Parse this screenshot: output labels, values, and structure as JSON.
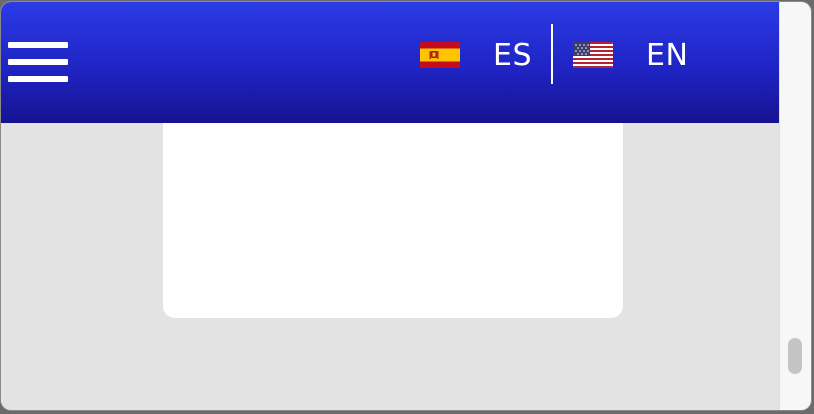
{
  "header": {
    "menu_icon": "hamburger-menu-icon",
    "languages": [
      {
        "code": "ES",
        "flag": "spain-flag-icon"
      },
      {
        "code": "EN",
        "flag": "us-flag-icon"
      }
    ]
  },
  "colors": {
    "header_top": "#2b3be6",
    "header_bottom": "#161391",
    "page_background": "#e3e3e3",
    "card_background": "#ffffff"
  }
}
